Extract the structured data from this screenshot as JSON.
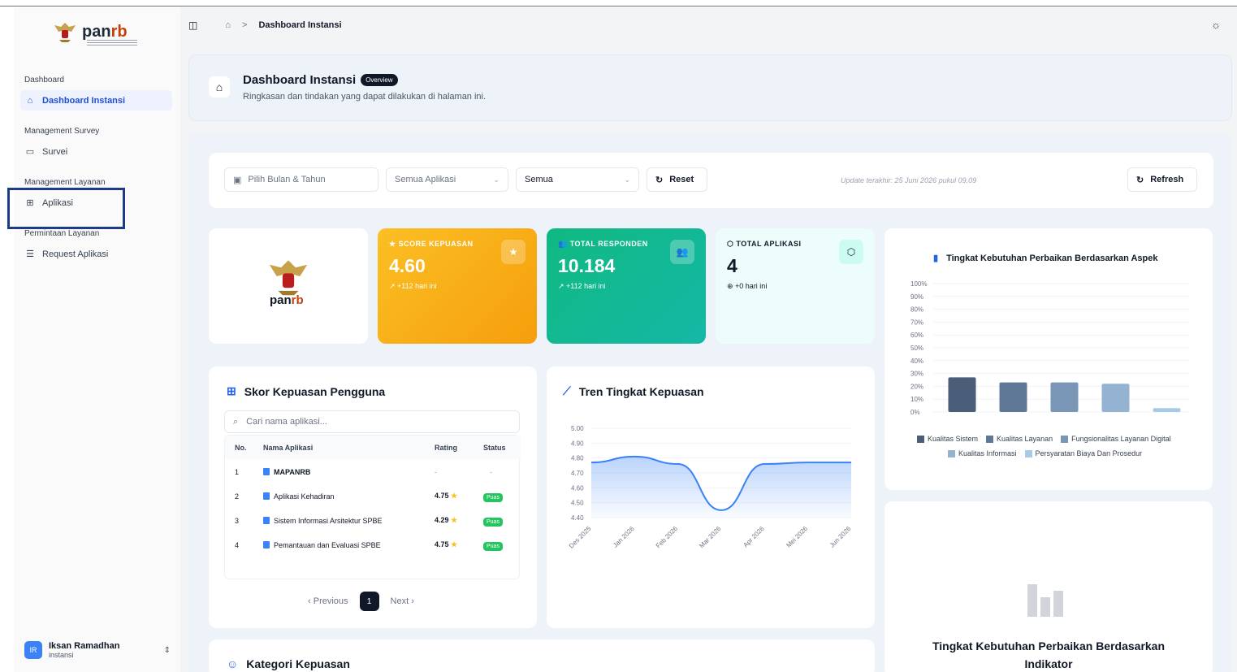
{
  "brand": {
    "name_left": "pan",
    "name_right": "rb"
  },
  "sidebar": {
    "sections": [
      {
        "label": "Dashboard"
      },
      {
        "label": "Management Survey"
      },
      {
        "label": "Management Layanan"
      },
      {
        "label": "Permintaan Layanan"
      }
    ],
    "items": [
      {
        "label": "Dashboard Instansi",
        "icon": "home-icon",
        "active": true
      },
      {
        "label": "Survei",
        "icon": "message-square-icon"
      },
      {
        "label": "Aplikasi",
        "icon": "table-icon"
      },
      {
        "label": "Request Aplikasi",
        "icon": "list-icon"
      }
    ],
    "user": {
      "initials": "IR",
      "name": "Iksan Ramadhan",
      "role": "instansi"
    }
  },
  "header": {
    "breadcrumb_current": "Dashboard Instansi",
    "separator": ">"
  },
  "page": {
    "title": "Dashboard Instansi",
    "badge": "Overview",
    "subtitle": "Ringkasan dan tindakan yang dapat dilakukan di halaman ini."
  },
  "filters": {
    "date_placeholder": "Pilih Bulan & Tahun",
    "app_select": "Semua Aplikasi",
    "status_select": "Semua",
    "reset_label": "Reset",
    "update_text": "Update terakhir: 25 Juni 2026 pukul 09.09",
    "refresh_label": "Refresh"
  },
  "stats": [
    {
      "label": "SCORE KEPUASAN",
      "value": "4.60",
      "delta": "↗ +112 hari ini",
      "color": "#f59e0b"
    },
    {
      "label": "TOTAL RESPONDEN",
      "value": "10.184",
      "delta": "↗ +112 hari ini",
      "color": "#10b981"
    },
    {
      "label": "TOTAL APLIKASI",
      "value": "4",
      "delta": "⊕ +0 hari ini",
      "color": "#ecfdfb"
    }
  ],
  "table": {
    "title": "Skor Kepuasan Pengguna",
    "search_placeholder": "Cari nama aplikasi...",
    "headers": {
      "no": "No.",
      "name": "Nama Aplikasi",
      "rating": "Rating",
      "status": "Status"
    },
    "rows": [
      {
        "no": "1",
        "name": "MAPANRB",
        "rating": "-",
        "status": "-"
      },
      {
        "no": "2",
        "name": "Aplikasi Kehadiran",
        "rating": "4.75",
        "status": "Puas"
      },
      {
        "no": "3",
        "name": "Sistem Informasi Arsitektur SPBE",
        "rating": "4.29",
        "status": "Puas"
      },
      {
        "no": "4",
        "name": "Pemantauan dan Evaluasi SPBE",
        "rating": "4.75",
        "status": "Puas"
      }
    ],
    "pager": {
      "prev": "Previous",
      "page": "1",
      "next": "Next"
    }
  },
  "sections": {
    "kategori_title": "Kategori Kepuasan",
    "indikator_title": "Tingkat Kebutuhan Perbaikan Berdasarkan Indikator"
  },
  "chart_data": [
    {
      "type": "line",
      "title": "Tren Tingkat Kepuasan",
      "x": [
        "Des 2025",
        "Jan 2026",
        "Feb 2026",
        "Mar 2026",
        "Apr 2026",
        "Mei 2026",
        "Jun 2026"
      ],
      "values": [
        4.77,
        4.81,
        4.76,
        4.45,
        4.76,
        4.77,
        4.77
      ],
      "ylim": [
        4.4,
        5.0
      ],
      "yticks": [
        "5.00",
        "4.90",
        "4.80",
        "4.70",
        "4.60",
        "4.50",
        "4.40"
      ],
      "color": "#3b82f6"
    },
    {
      "type": "bar",
      "title": "Tingkat Kebutuhan Perbaikan Berdasarkan Aspek",
      "categories": [
        "Kualitas Sistem",
        "Kualitas Layanan",
        "Fungsionalitas Layanan Digital",
        "Kualitas Informasi",
        "Persyaratan Biaya Dan Prosedur"
      ],
      "values": [
        27,
        23,
        23,
        22,
        3
      ],
      "colors": [
        "#4b5e79",
        "#5f7898",
        "#7996b6",
        "#94b3d2",
        "#a9c9e8"
      ],
      "ylim": [
        0,
        100
      ],
      "yticks": [
        "100%",
        "90%",
        "80%",
        "70%",
        "60%",
        "50%",
        "40%",
        "30%",
        "20%",
        "10%",
        "0%"
      ],
      "legend": "bottom"
    }
  ]
}
